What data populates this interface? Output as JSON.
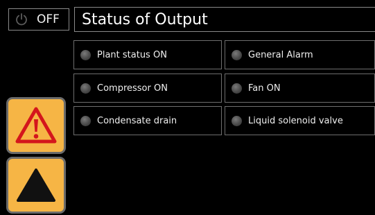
{
  "power": {
    "state_label": "OFF",
    "icon": "power-icon"
  },
  "header": {
    "title": "Status of Output"
  },
  "outputs": [
    {
      "label": "Plant status ON",
      "icon": "status-led-icon"
    },
    {
      "label": "General Alarm",
      "icon": "status-led-icon"
    },
    {
      "label": "Compressor ON",
      "icon": "status-led-icon"
    },
    {
      "label": "Fan ON",
      "icon": "status-led-icon"
    },
    {
      "label": "Condensate drain",
      "icon": "status-led-icon"
    },
    {
      "label": "Liquid solenoid valve",
      "icon": "status-led-icon"
    }
  ],
  "side_buttons": [
    {
      "name": "alarm-button",
      "icon": "warning-triangle-icon"
    },
    {
      "name": "up-button",
      "icon": "up-arrow-icon"
    }
  ],
  "colors": {
    "background": "#000000",
    "button_fill": "#f6b545",
    "warning_red": "#d4161c",
    "led_off": "#5a5a5a"
  }
}
